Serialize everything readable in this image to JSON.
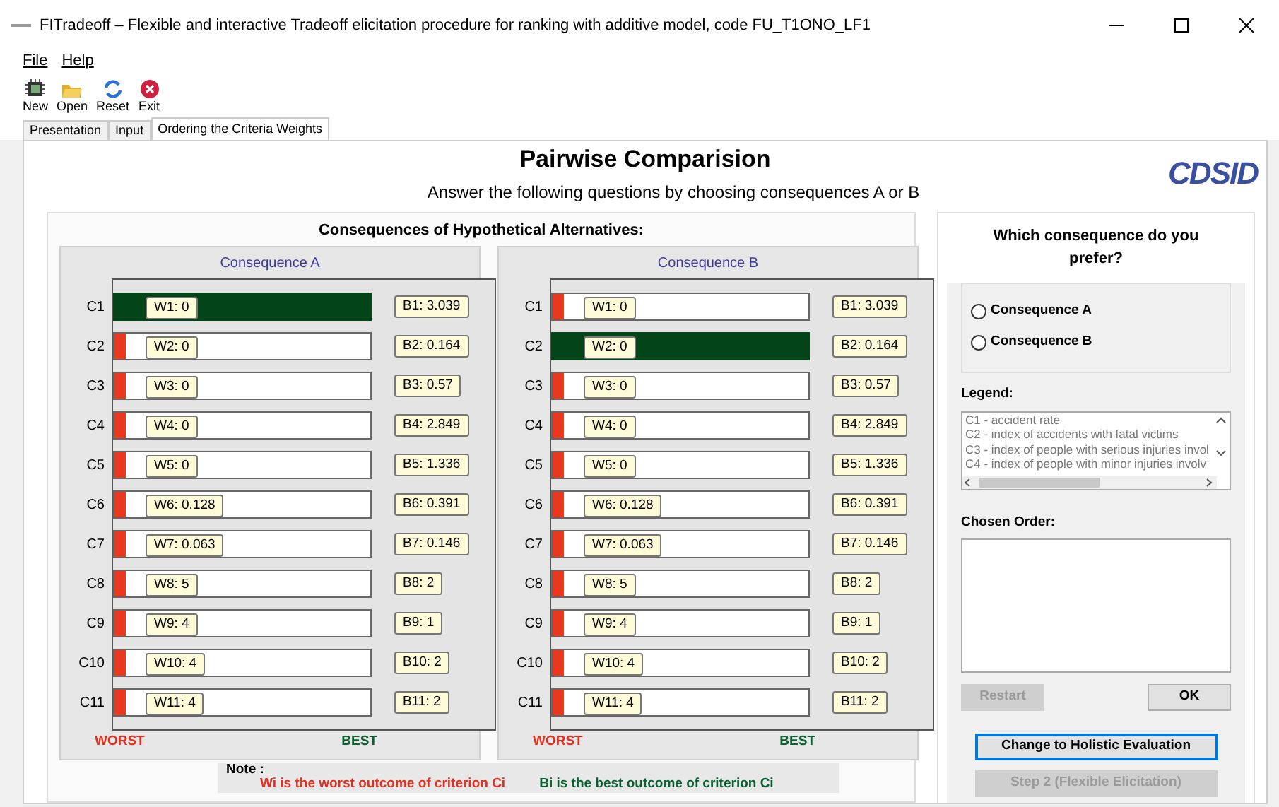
{
  "window": {
    "title": "FITradeoff – Flexible and interactive Tradeoff elicitation procedure for ranking with additive model, code FU_T1ONO_LF1"
  },
  "menu": [
    "File",
    "Help"
  ],
  "toolbar": [
    {
      "label": "New",
      "kind": "new"
    },
    {
      "label": "Open",
      "kind": "open"
    },
    {
      "label": "Reset",
      "kind": "reset"
    },
    {
      "label": "Exit",
      "kind": "exit"
    }
  ],
  "tabs": [
    {
      "label": "Presentation",
      "selected": false
    },
    {
      "label": "Input",
      "selected": false
    },
    {
      "label": "Ordering the Criteria Weights",
      "selected": true
    }
  ],
  "heading": "Pairwise Comparision",
  "instruction": "Answer the following questions by choosing consequences A or B",
  "logo": "CDSID",
  "consequences_title": "Consequences of Hypothetical Alternatives:",
  "charts": [
    {
      "title": "Consequence A",
      "worst_label": "WORST",
      "best_label": "BEST",
      "rows": [
        {
          "label": "C1",
          "worst": "W1: 0",
          "best": "B1: 3.039",
          "selected": true
        },
        {
          "label": "C2",
          "worst": "W2: 0",
          "best": "B2: 0.164",
          "selected": false
        },
        {
          "label": "C3",
          "worst": "W3: 0",
          "best": "B3: 0.57",
          "selected": false
        },
        {
          "label": "C4",
          "worst": "W4: 0",
          "best": "B4: 2.849",
          "selected": false
        },
        {
          "label": "C5",
          "worst": "W5: 0",
          "best": "B5: 1.336",
          "selected": false
        },
        {
          "label": "C6",
          "worst": "W6: 0.128",
          "best": "B6: 0.391",
          "selected": false
        },
        {
          "label": "C7",
          "worst": "W7: 0.063",
          "best": "B7: 0.146",
          "selected": false
        },
        {
          "label": "C8",
          "worst": "W8: 5",
          "best": "B8: 2",
          "selected": false
        },
        {
          "label": "C9",
          "worst": "W9: 4",
          "best": "B9: 1",
          "selected": false
        },
        {
          "label": "C10",
          "worst": "W10: 4",
          "best": "B10: 2",
          "selected": false
        },
        {
          "label": "C11",
          "worst": "W11: 4",
          "best": "B11: 2",
          "selected": false
        }
      ]
    },
    {
      "title": "Consequence B",
      "worst_label": "WORST",
      "best_label": "BEST",
      "rows": [
        {
          "label": "C1",
          "worst": "W1: 0",
          "best": "B1: 3.039",
          "selected": false
        },
        {
          "label": "C2",
          "worst": "W2: 0",
          "best": "B2: 0.164",
          "selected": true
        },
        {
          "label": "C3",
          "worst": "W3: 0",
          "best": "B3: 0.57",
          "selected": false
        },
        {
          "label": "C4",
          "worst": "W4: 0",
          "best": "B4: 2.849",
          "selected": false
        },
        {
          "label": "C5",
          "worst": "W5: 0",
          "best": "B5: 1.336",
          "selected": false
        },
        {
          "label": "C6",
          "worst": "W6: 0.128",
          "best": "B6: 0.391",
          "selected": false
        },
        {
          "label": "C7",
          "worst": "W7: 0.063",
          "best": "B7: 0.146",
          "selected": false
        },
        {
          "label": "C8",
          "worst": "W8: 5",
          "best": "B8: 2",
          "selected": false
        },
        {
          "label": "C9",
          "worst": "W9: 4",
          "best": "B9: 1",
          "selected": false
        },
        {
          "label": "C10",
          "worst": "W10: 4",
          "best": "B10: 2",
          "selected": false
        },
        {
          "label": "C11",
          "worst": "W11: 4",
          "best": "B11: 2",
          "selected": false
        }
      ]
    }
  ],
  "note": {
    "title": "Note :",
    "worst_text": "Wi is the worst outcome of criterion Ci",
    "best_text": "Bi is the best outcome of criterion Ci"
  },
  "preference": {
    "question": "Which consequence do you prefer?",
    "options": [
      {
        "label": "Consequence A",
        "selected": false
      },
      {
        "label": "Consequence B",
        "selected": false
      }
    ],
    "legend_label": "Legend:",
    "legend": [
      "C1 - accident rate",
      "C2 - index of accidents with fatal victims",
      "C3 - index of people with serious injuries invol",
      "C4 - index of people with minor injuries involv"
    ],
    "order_label": "Chosen Order:",
    "buttons": [
      {
        "label": "Restart",
        "disabled": true,
        "focused": false
      },
      {
        "label": "OK",
        "disabled": false,
        "focused": false
      }
    ],
    "actions": [
      {
        "label": "Change to Holistic Evaluation",
        "disabled": false,
        "focused": true
      },
      {
        "label": "Step 2 (Flexible Elicitation)",
        "disabled": true,
        "focused": false
      }
    ]
  }
}
